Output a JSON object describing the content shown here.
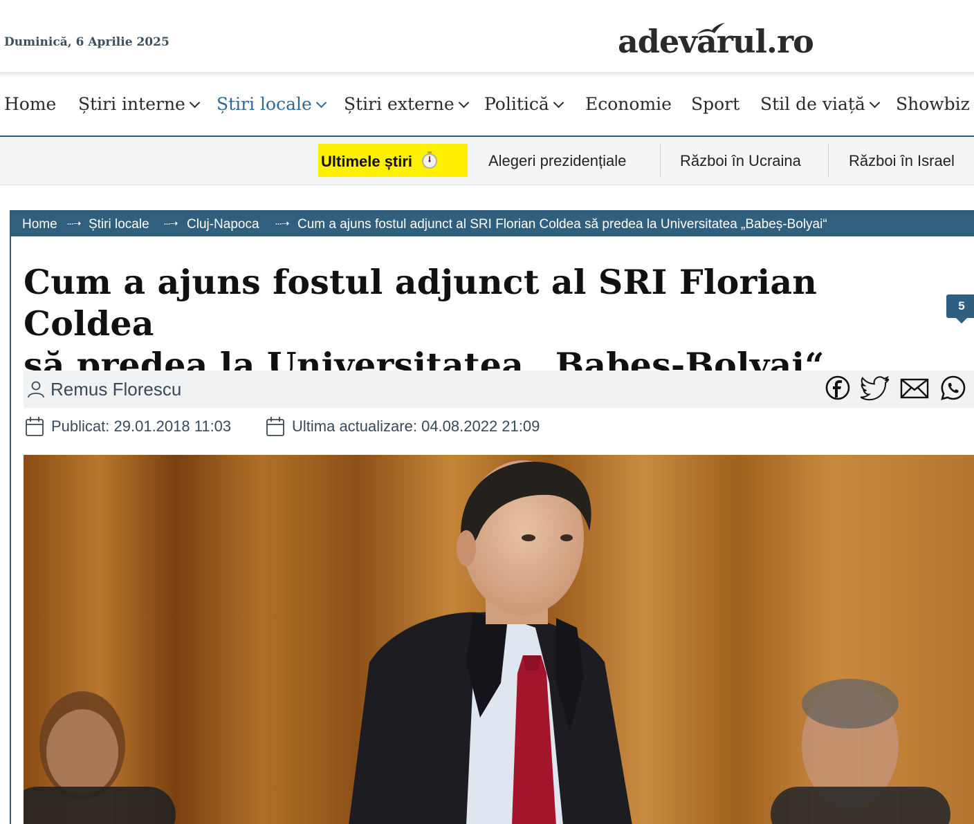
{
  "header": {
    "date": "Duminică, 6 Aprilie 2025",
    "logo_text": "adevarul.ro",
    "logo_icon": "bird-logo-icon"
  },
  "main_nav": {
    "items": [
      {
        "label": "Home",
        "has_dropdown": false,
        "active": false
      },
      {
        "label": "Știri interne",
        "has_dropdown": true,
        "active": false
      },
      {
        "label": "Știri locale",
        "has_dropdown": true,
        "active": true
      },
      {
        "label": "Știri externe",
        "has_dropdown": true,
        "active": false
      },
      {
        "label": "Politică",
        "has_dropdown": true,
        "active": false
      },
      {
        "label": "Economie",
        "has_dropdown": false,
        "active": false
      },
      {
        "label": "Sport",
        "has_dropdown": false,
        "active": false
      },
      {
        "label": "Stil de viață",
        "has_dropdown": true,
        "active": false
      },
      {
        "label": "Showbiz",
        "has_dropdown": true,
        "active": false
      }
    ]
  },
  "sub_nav": {
    "latest_label": "Ultimele știri",
    "latest_icon": "stopwatch-icon",
    "items": [
      "Alegeri prezidențiale",
      "Război în Ucraina",
      "Război în Israel"
    ]
  },
  "breadcrumb": {
    "items": [
      "Home",
      "Știri locale",
      "Cluj-Napoca",
      "Cum a ajuns fostul adjunct al SRI Florian Coldea să predea la Universitatea „Babeș-Bolyai“"
    ],
    "separator_icon": "dotted-arrow-icon"
  },
  "article": {
    "title_line1": "Cum a ajuns fostul adjunct al SRI Florian Coldea",
    "title_line2": "să predea la Universitatea „Babeș-Bolyai“",
    "comment_count": "5",
    "author": "Remus Florescu",
    "published_label": "Publicat:",
    "published_value": "29.01.2018 11:03",
    "updated_label": "Ultima actualizare:",
    "updated_value": "04.08.2022 21:09",
    "share_icons": [
      "facebook-icon",
      "twitter-icon",
      "email-icon",
      "whatsapp-icon"
    ]
  },
  "colors": {
    "brand_blue": "#315f7e",
    "active_nav": "#2e6a93",
    "latest_highlight": "#fdf000"
  }
}
